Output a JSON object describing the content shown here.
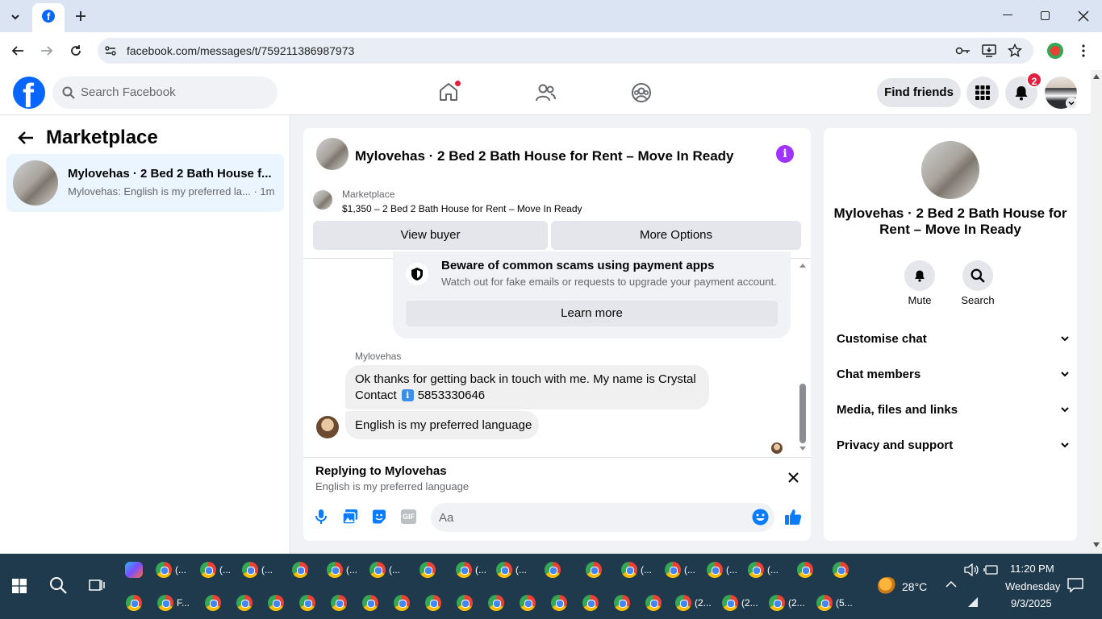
{
  "browser": {
    "url": "facebook.com/messages/t/759211386987973"
  },
  "header": {
    "search_placeholder": "Search Facebook",
    "find_friends": "Find friends",
    "notifications_count": "2"
  },
  "left": {
    "title": "Marketplace",
    "conversation": {
      "name": "Mylovehas · 2 Bed 2 Bath House f...",
      "preview": "Mylovehas: English is my preferred la... · 1m"
    }
  },
  "chat": {
    "title": "Mylovehas · 2 Bed 2 Bath House for Rent – Move In Ready",
    "marketplace_label": "Marketplace",
    "listing": "$1,350 – 2 Bed 2 Bath House for Rent – Move In Ready",
    "view_buyer": "View buyer",
    "more_options": "More Options",
    "scam_title": "Beware of common scams using payment apps",
    "scam_sub": "Watch out for fake emails or requests to upgrade your payment account.",
    "learn_more": "Learn more",
    "sender": "Mylovehas",
    "message1_line1": "Ok thanks for getting back in touch with me. My name is Crystal",
    "message1_line2": "Contact",
    "message1_phone": "5853330646",
    "message2": "English is my preferred language",
    "replying_to": "Replying to Mylovehas",
    "replying_text": "English is my preferred language",
    "input_placeholder": "Aa"
  },
  "right": {
    "title": "Mylovehas · 2 Bed 2 Bath House for Rent – Move In Ready",
    "mute": "Mute",
    "search": "Search",
    "rows": [
      "Customise chat",
      "Chat members",
      "Media, files and links",
      "Privacy and support"
    ]
  },
  "taskbar": {
    "weather": "28°C",
    "time": "11:20 PM",
    "day": "Wednesday",
    "date": "9/3/2025",
    "row1_labels": [
      "(...",
      "(...",
      "(...",
      "",
      "(...",
      "(...",
      "",
      "(...",
      "(...",
      "",
      "",
      "(...",
      "(...",
      "(...",
      "(...",
      "",
      ""
    ],
    "row2_labels": [
      "",
      "F...",
      "",
      "",
      "",
      "",
      "",
      "",
      "",
      "",
      "",
      "",
      "",
      "",
      "",
      "",
      "",
      "(2...",
      "(2...",
      "(2...",
      "(5..."
    ]
  },
  "colors": {
    "fb_blue": "#0866ff",
    "messenger_blue": "#0a7cff",
    "notification_red": "#e41e3f"
  }
}
